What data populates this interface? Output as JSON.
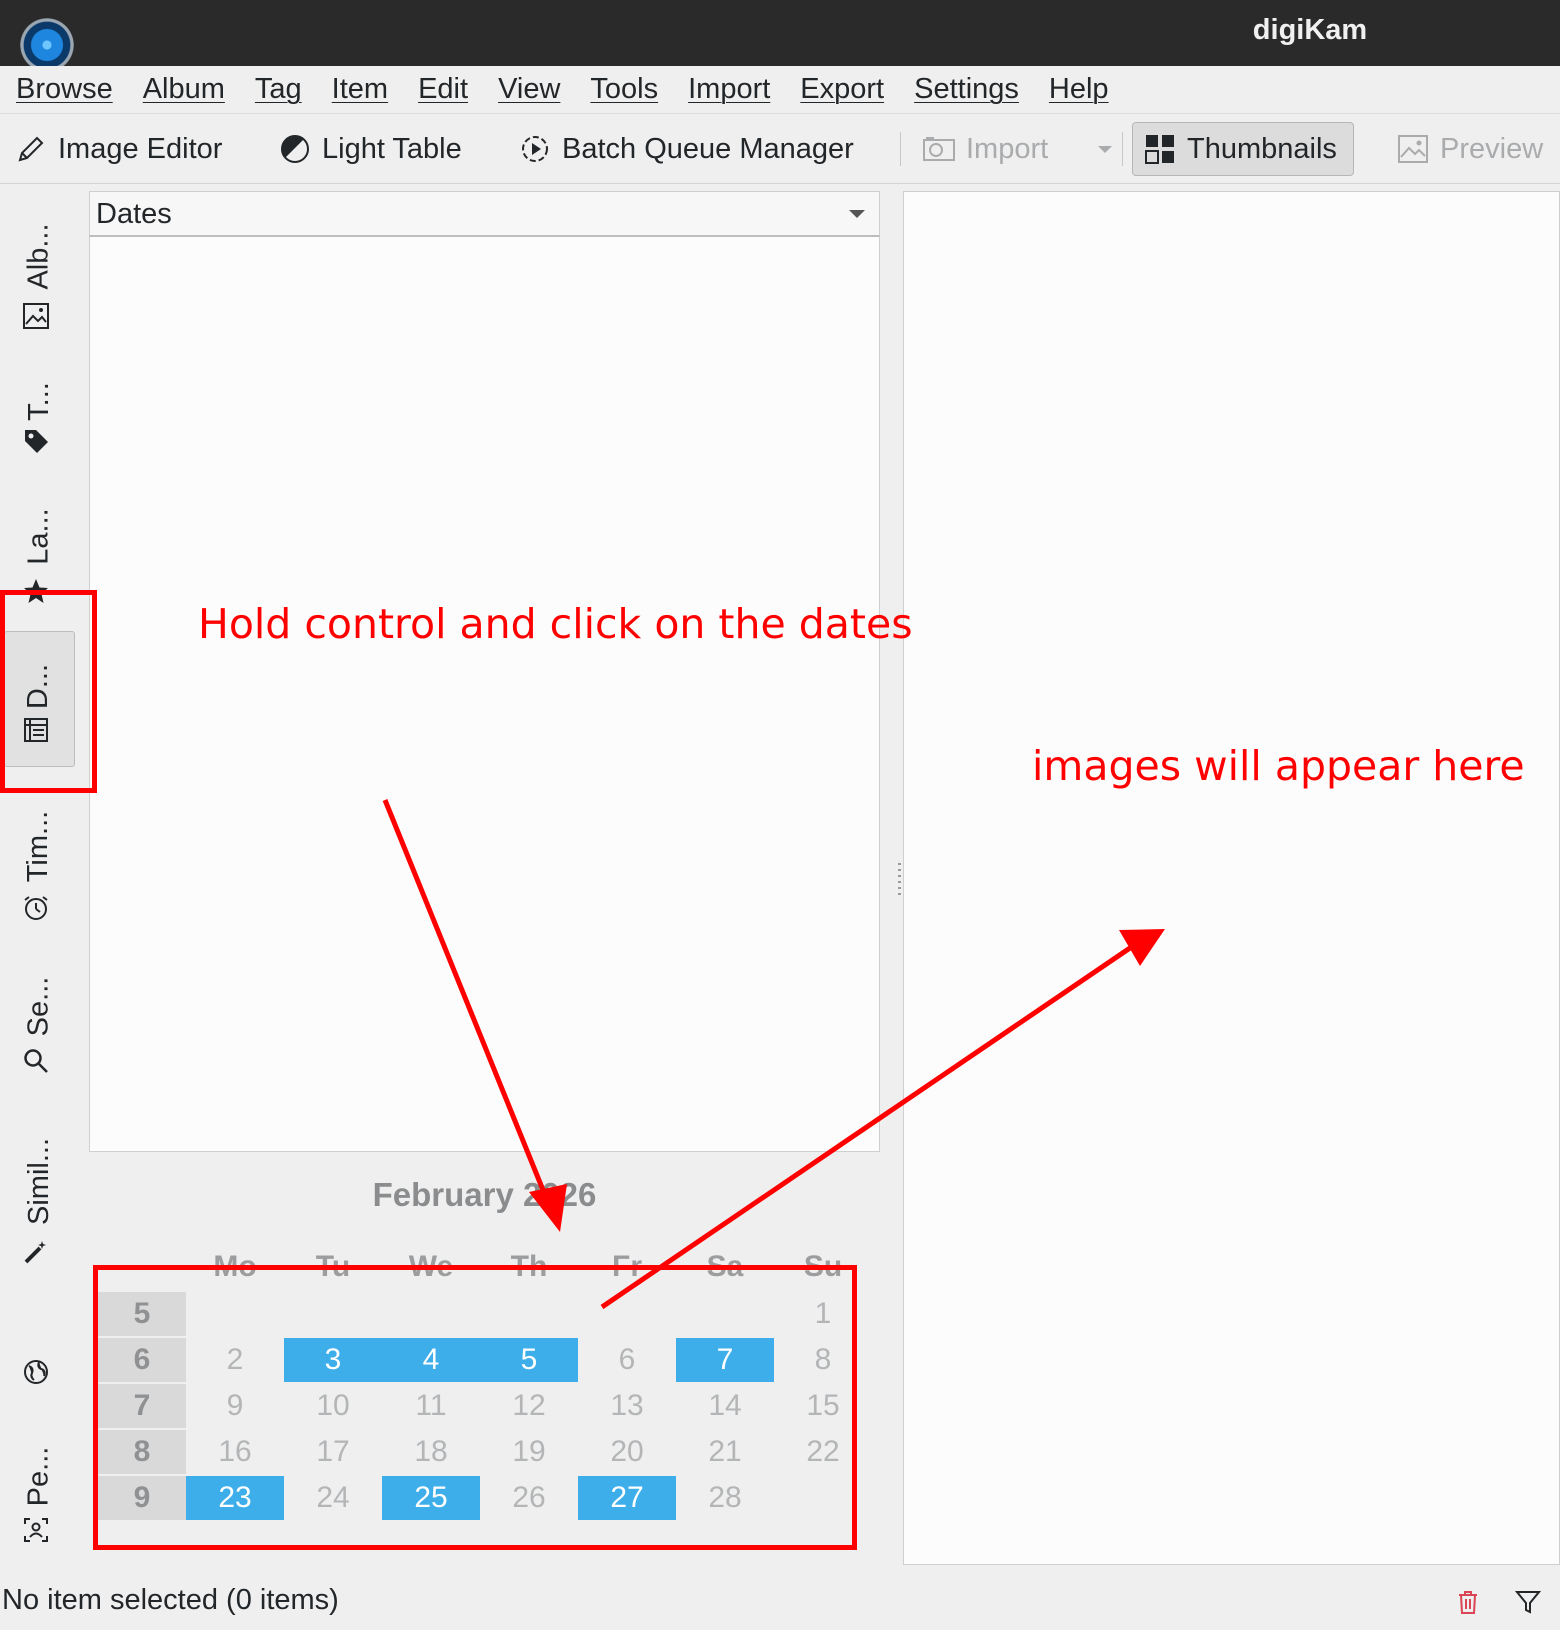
{
  "window": {
    "title": "digiKam"
  },
  "menu": {
    "items": [
      "Browse",
      "Album",
      "Tag",
      "Item",
      "Edit",
      "View",
      "Tools",
      "Import",
      "Export",
      "Settings",
      "Help"
    ]
  },
  "toolbar": {
    "image_editor": "Image Editor",
    "light_table": "Light Table",
    "batch_queue": "Batch Queue Manager",
    "import": "Import",
    "thumbnails": "Thumbnails",
    "preview": "Preview"
  },
  "sidebar": {
    "tabs": [
      "Alb...",
      "T...",
      "La...",
      "D...",
      "Tim...",
      "Se...",
      "Simil...",
      "Pe..."
    ],
    "active": "D..."
  },
  "dates_panel": {
    "combo_value": "Dates"
  },
  "calendar": {
    "title": "February 2026",
    "weekdays": [
      "Mo",
      "Tu",
      "We",
      "Th",
      "Fr",
      "Sa",
      "Su"
    ],
    "weeks": [
      {
        "num": "5",
        "days": [
          "",
          "",
          "",
          "",
          "",
          "",
          "1"
        ]
      },
      {
        "num": "6",
        "days": [
          "2",
          "3",
          "4",
          "5",
          "6",
          "7",
          "8"
        ]
      },
      {
        "num": "7",
        "days": [
          "9",
          "10",
          "11",
          "12",
          "13",
          "14",
          "15"
        ]
      },
      {
        "num": "8",
        "days": [
          "16",
          "17",
          "18",
          "19",
          "20",
          "21",
          "22"
        ]
      },
      {
        "num": "9",
        "days": [
          "23",
          "24",
          "25",
          "26",
          "27",
          "28",
          ""
        ]
      }
    ],
    "selected": [
      "3",
      "4",
      "5",
      "7",
      "23",
      "25",
      "27"
    ],
    "selection_color": "#3daee9"
  },
  "status": {
    "text": "No item selected (0 items)"
  },
  "annotations": {
    "instruction": "Hold control and click on the dates",
    "result": "images will appear here",
    "color": "#ff0000"
  }
}
